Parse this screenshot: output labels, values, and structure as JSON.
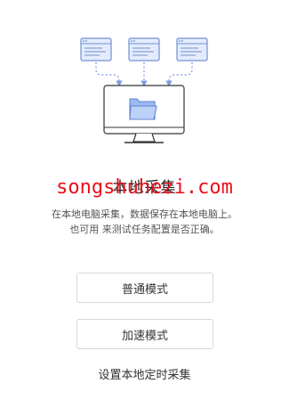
{
  "illustration": {
    "pages": [
      {
        "icon": "web-page-icon"
      },
      {
        "icon": "web-page-icon"
      },
      {
        "icon": "web-page-icon"
      }
    ],
    "computer_icon": "monitor-icon",
    "folder_icon": "folder-icon",
    "colors": {
      "page_fill": "#e4ecfb",
      "page_stroke": "#6f8fd8",
      "arrow": "#7e9be0",
      "folder_fill": "#8fb0f0",
      "monitor_stroke": "#333333"
    }
  },
  "title": "本地采集",
  "watermark": "songshuhezi.com",
  "description": {
    "line1": "在本地电脑采集，数据保存在本地电脑上。",
    "line2": "也可用 来测试任务配置是否正确。"
  },
  "buttons": {
    "normal_mode": "普通模式",
    "fast_mode": "加速模式"
  },
  "schedule_link": "设置本地定时采集"
}
